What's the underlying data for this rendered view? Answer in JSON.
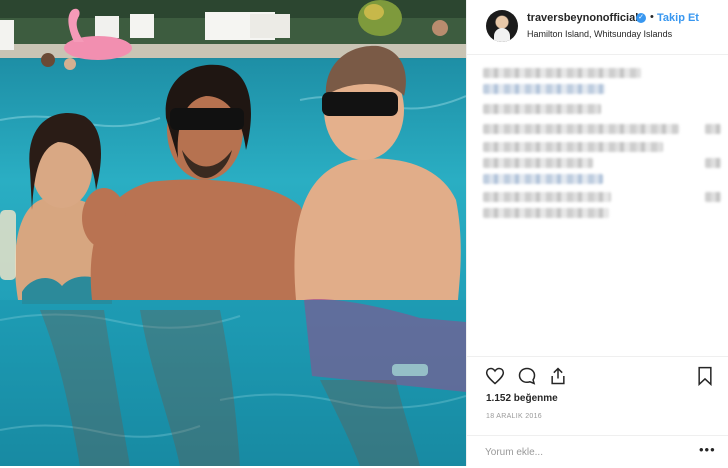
{
  "post": {
    "username": "traversbeynonofficial",
    "separator": "•",
    "follow_label": "Takip Et",
    "location": "Hamilton Island, Whitsunday Islands",
    "likes": "1.152 beğenme",
    "date": "18 ARALIK 2016",
    "comment_placeholder": "Yorum ekle...",
    "more_label": "•••"
  },
  "icons": {
    "verified": "verified-badge-icon",
    "like": "heart-icon",
    "comment": "comment-bubble-icon",
    "share": "share-icon",
    "save": "bookmark-icon"
  },
  "colors": {
    "accent": "#3897f0",
    "text": "#262626",
    "muted": "#999999",
    "pool": "#2aaec3"
  }
}
